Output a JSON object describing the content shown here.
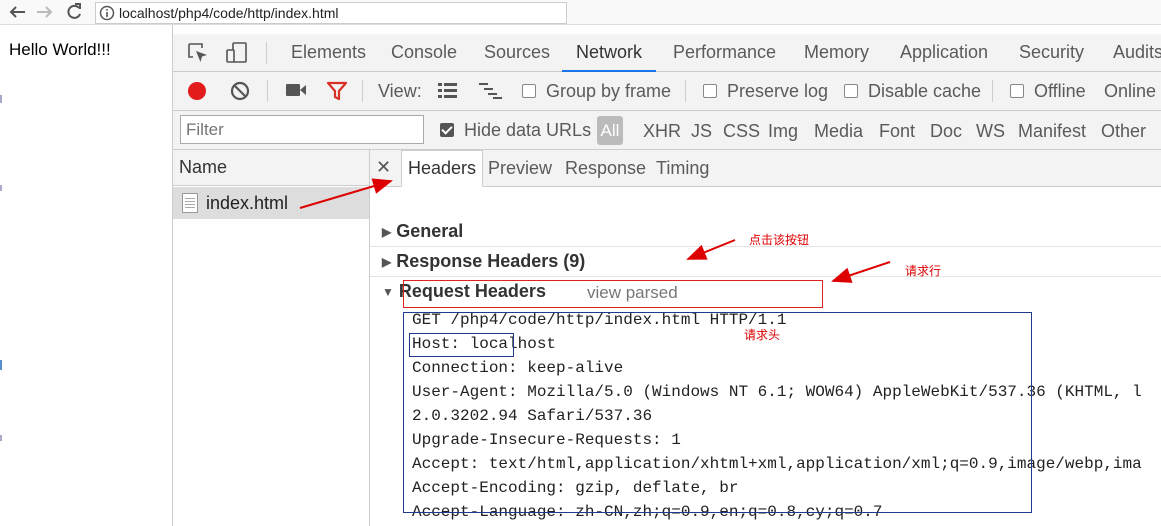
{
  "browser": {
    "url": "localhost/php4/code/http/index.html"
  },
  "page": {
    "hello": "Hello World!!!"
  },
  "devtools": {
    "tabs": [
      "Elements",
      "Console",
      "Sources",
      "Network",
      "Performance",
      "Memory",
      "Application",
      "Security",
      "Audits"
    ],
    "active_tab": "Network",
    "toolbar": {
      "view_label": "View:",
      "group_by_frame": "Group by frame",
      "preserve_log": "Preserve log",
      "disable_cache": "Disable cache",
      "offline": "Offline",
      "online": "Online"
    },
    "filter": {
      "placeholder": "Filter",
      "hide_data_urls": "Hide data URLs",
      "types": [
        "All",
        "XHR",
        "JS",
        "CSS",
        "Img",
        "Media",
        "Font",
        "Doc",
        "WS",
        "Manifest",
        "Other"
      ]
    },
    "requests": {
      "column_name": "Name",
      "items": [
        "index.html"
      ]
    },
    "detail": {
      "tabs": [
        "Headers",
        "Preview",
        "Response",
        "Timing"
      ],
      "general": "General",
      "response_headers": "Response Headers (9)",
      "request_headers": "Request Headers",
      "view_parsed": "view parsed",
      "request_line": "GET /php4/code/http/index.html HTTP/1.1",
      "headers": [
        "Host: localhost",
        "User-Agent: Mozilla/5.0 (Windows NT 6.1; WOW64) AppleWebKit/537.36 (KHTML, l",
        "2.0.3202.94 Safari/537.36",
        "Upgrade-Insecure-Requests: 1",
        "Accept: text/html,application/xhtml+xml,application/xml;q=0.9,image/webp,ima",
        "Accept-Encoding: gzip, deflate, br",
        "Accept-Language: zh-CN,zh;q=0.9,en;q=0.8,cy;q=0.7"
      ],
      "connection_key": "Connection",
      "connection_value": ": keep-alive"
    }
  },
  "annotations": {
    "click_button": "点击该按钮",
    "request_line": "请求行",
    "request_header": "请求头"
  },
  "colors": {
    "record": "#e21b1b",
    "filter_icon": "#d93025",
    "annotation": "#dd0000",
    "box_blue": "#223a8a",
    "active_tab_underline": "#1a73e8"
  }
}
